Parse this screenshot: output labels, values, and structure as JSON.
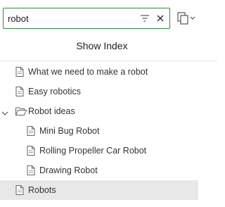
{
  "search": {
    "value": "robot",
    "placeholder": ""
  },
  "actions": {
    "show_index": "Show Index"
  },
  "colors": {
    "accent": "#2e8b3e",
    "selected_row": "#e8e8e8"
  },
  "icons": {
    "filter": "filter-icon",
    "clear": "close-icon",
    "copy": "copy-icon",
    "document": "document-icon",
    "folder": "folder-open-icon",
    "chevron": "chevron-down-icon"
  },
  "tree": [
    {
      "label": "What we need to make a robot",
      "type": "page",
      "level": 0
    },
    {
      "label": "Easy robotics",
      "type": "page",
      "level": 0
    },
    {
      "label": "Robot ideas",
      "type": "folder",
      "level": 0,
      "expanded": true
    },
    {
      "label": "Mini Bug Robot",
      "type": "page",
      "level": 1
    },
    {
      "label": "Rolling Propeller Car Robot",
      "type": "page",
      "level": 1
    },
    {
      "label": "Drawing Robot",
      "type": "page",
      "level": 1
    },
    {
      "label": "Robots",
      "type": "page",
      "level": 0,
      "selected": true
    }
  ]
}
